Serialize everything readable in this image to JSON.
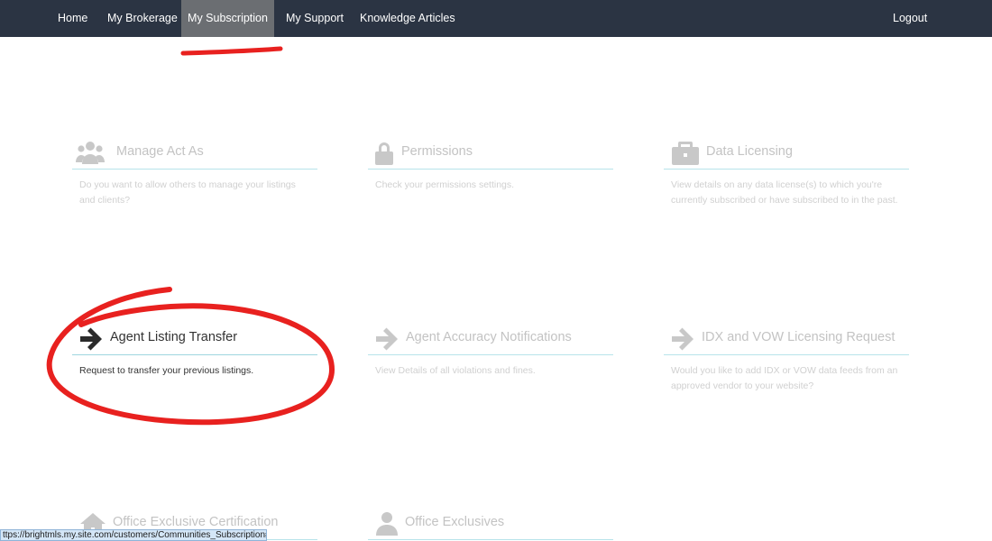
{
  "nav": {
    "items": [
      "Home",
      "My Brokerage",
      "My Subscription",
      "My Support",
      "Knowledge Articles"
    ],
    "active": "My Subscription",
    "logout": "Logout"
  },
  "tiles": [
    {
      "title": "Manage Act As",
      "desc": "Do you want to allow others to manage your listings and clients?",
      "icon": "users-icon"
    },
    {
      "title": "Permissions",
      "desc": "Check your permissions settings.",
      "icon": "lock-icon"
    },
    {
      "title": "Data Licensing",
      "desc": "View details on any data license(s) to which you're currently subscribed or have subscribed to in the past.",
      "icon": "briefcase-icon"
    },
    {
      "title": "Agent Listing Transfer",
      "desc": "Request to transfer your previous listings.",
      "icon": "arrow-right-icon"
    },
    {
      "title": "Agent Accuracy Notifications",
      "desc": "View Details of all violations and fines.",
      "icon": "arrow-right-icon"
    },
    {
      "title": "IDX and VOW Licensing Request",
      "desc": "Would you like to add IDX or VOW data feeds from an approved vendor to your website?",
      "icon": "arrow-right-icon"
    },
    {
      "title": "Office Exclusive Certification",
      "desc": "",
      "icon": "house-icon"
    },
    {
      "title": "Office Exclusives",
      "desc": "",
      "icon": "user-icon"
    }
  ],
  "status_url": "ttps://brightmls.my.site.com/customers/Communities_Subscription#",
  "colors": {
    "navbar": "#2b3443",
    "active_tab": "#6b6e72",
    "annotation": "#e8211f",
    "divider": "#b7e3ea"
  }
}
